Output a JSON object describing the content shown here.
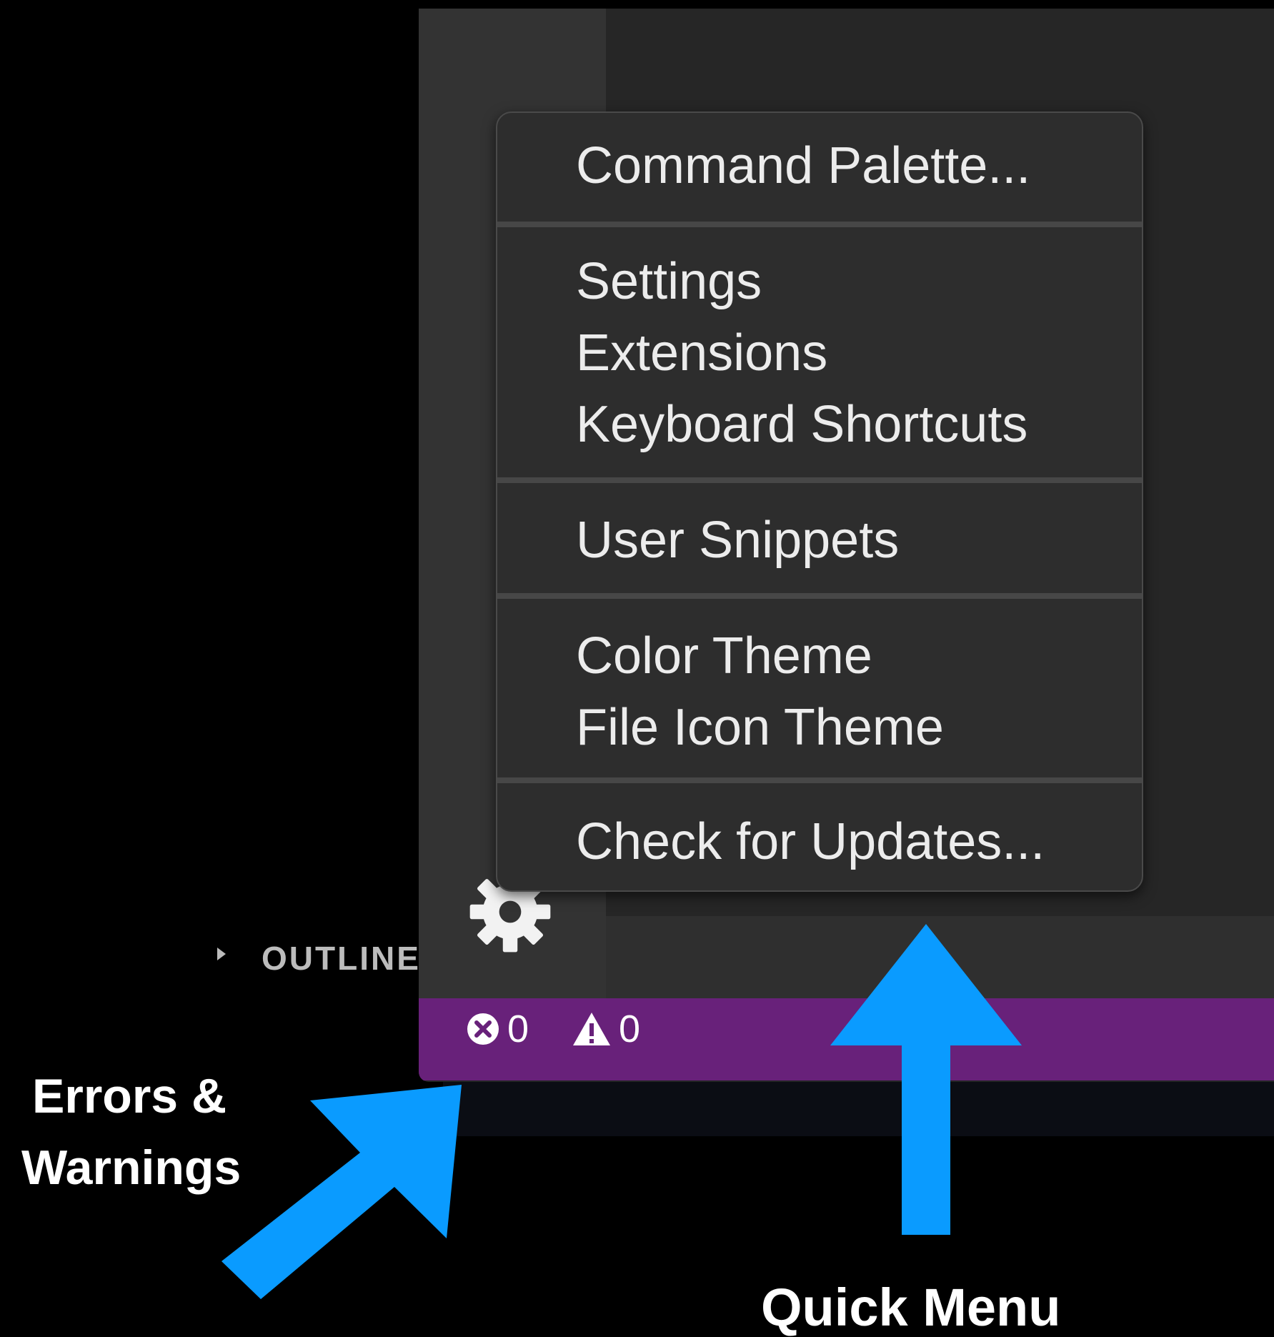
{
  "menu": {
    "groups": [
      {
        "items": [
          {
            "label": "Command Palette..."
          }
        ]
      },
      {
        "items": [
          {
            "label": "Settings"
          },
          {
            "label": "Extensions"
          },
          {
            "label": "Keyboard Shortcuts"
          }
        ]
      },
      {
        "items": [
          {
            "label": "User Snippets"
          }
        ]
      },
      {
        "items": [
          {
            "label": "Color Theme"
          },
          {
            "label": "File Icon Theme"
          }
        ]
      },
      {
        "items": [
          {
            "label": "Check for Updates..."
          }
        ]
      }
    ]
  },
  "sidebar": {
    "outline_label": "OUTLINE",
    "manage_icon": "gear-icon"
  },
  "status_bar": {
    "errors_count": "0",
    "warnings_count": "0",
    "errors_icon": "error-circle-icon",
    "warnings_icon": "warning-triangle-icon",
    "color": "#68217a"
  },
  "annotations": {
    "errors_line1": "Errors &",
    "errors_line2": "Warnings",
    "quick_menu": "Quick Menu",
    "arrow_color": "#0a9bff"
  }
}
